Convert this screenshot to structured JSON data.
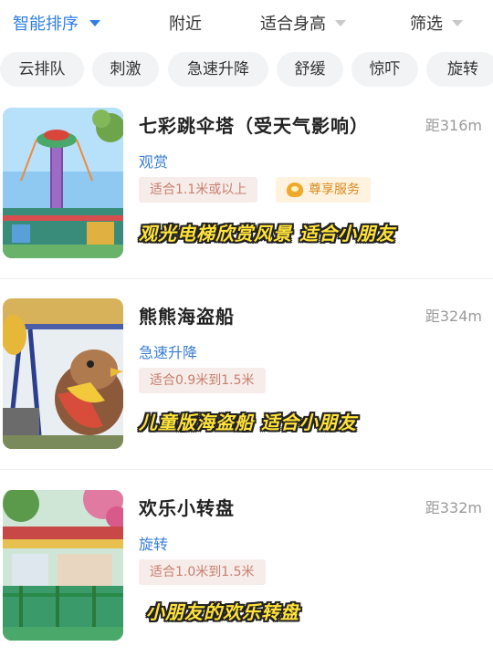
{
  "sortbar": {
    "items": [
      {
        "label": "智能排序"
      },
      {
        "label": "附近"
      },
      {
        "label": "适合身高"
      },
      {
        "label": "筛选"
      }
    ]
  },
  "chips": [
    "云排队",
    "刺激",
    "急速升降",
    "舒缓",
    "惊吓",
    "旋转"
  ],
  "cards": [
    {
      "title": "七彩跳伞塔（受天气影响）",
      "distance": "距316m",
      "category": "观赏",
      "height": "适合1.1米或以上",
      "vip": "尊享服务",
      "caption": "观光电梯欣赏风景 适合小朋友"
    },
    {
      "title": "熊熊海盗船",
      "distance": "距324m",
      "category": "急速升降",
      "height": "适合0.9米到1.5米",
      "caption": "儿童版海盗船 适合小朋友"
    },
    {
      "title": "欢乐小转盘",
      "distance": "距332m",
      "category": "旋转",
      "height": "适合1.0米到1.5米",
      "caption": "小朋友的欢乐转盘"
    }
  ]
}
